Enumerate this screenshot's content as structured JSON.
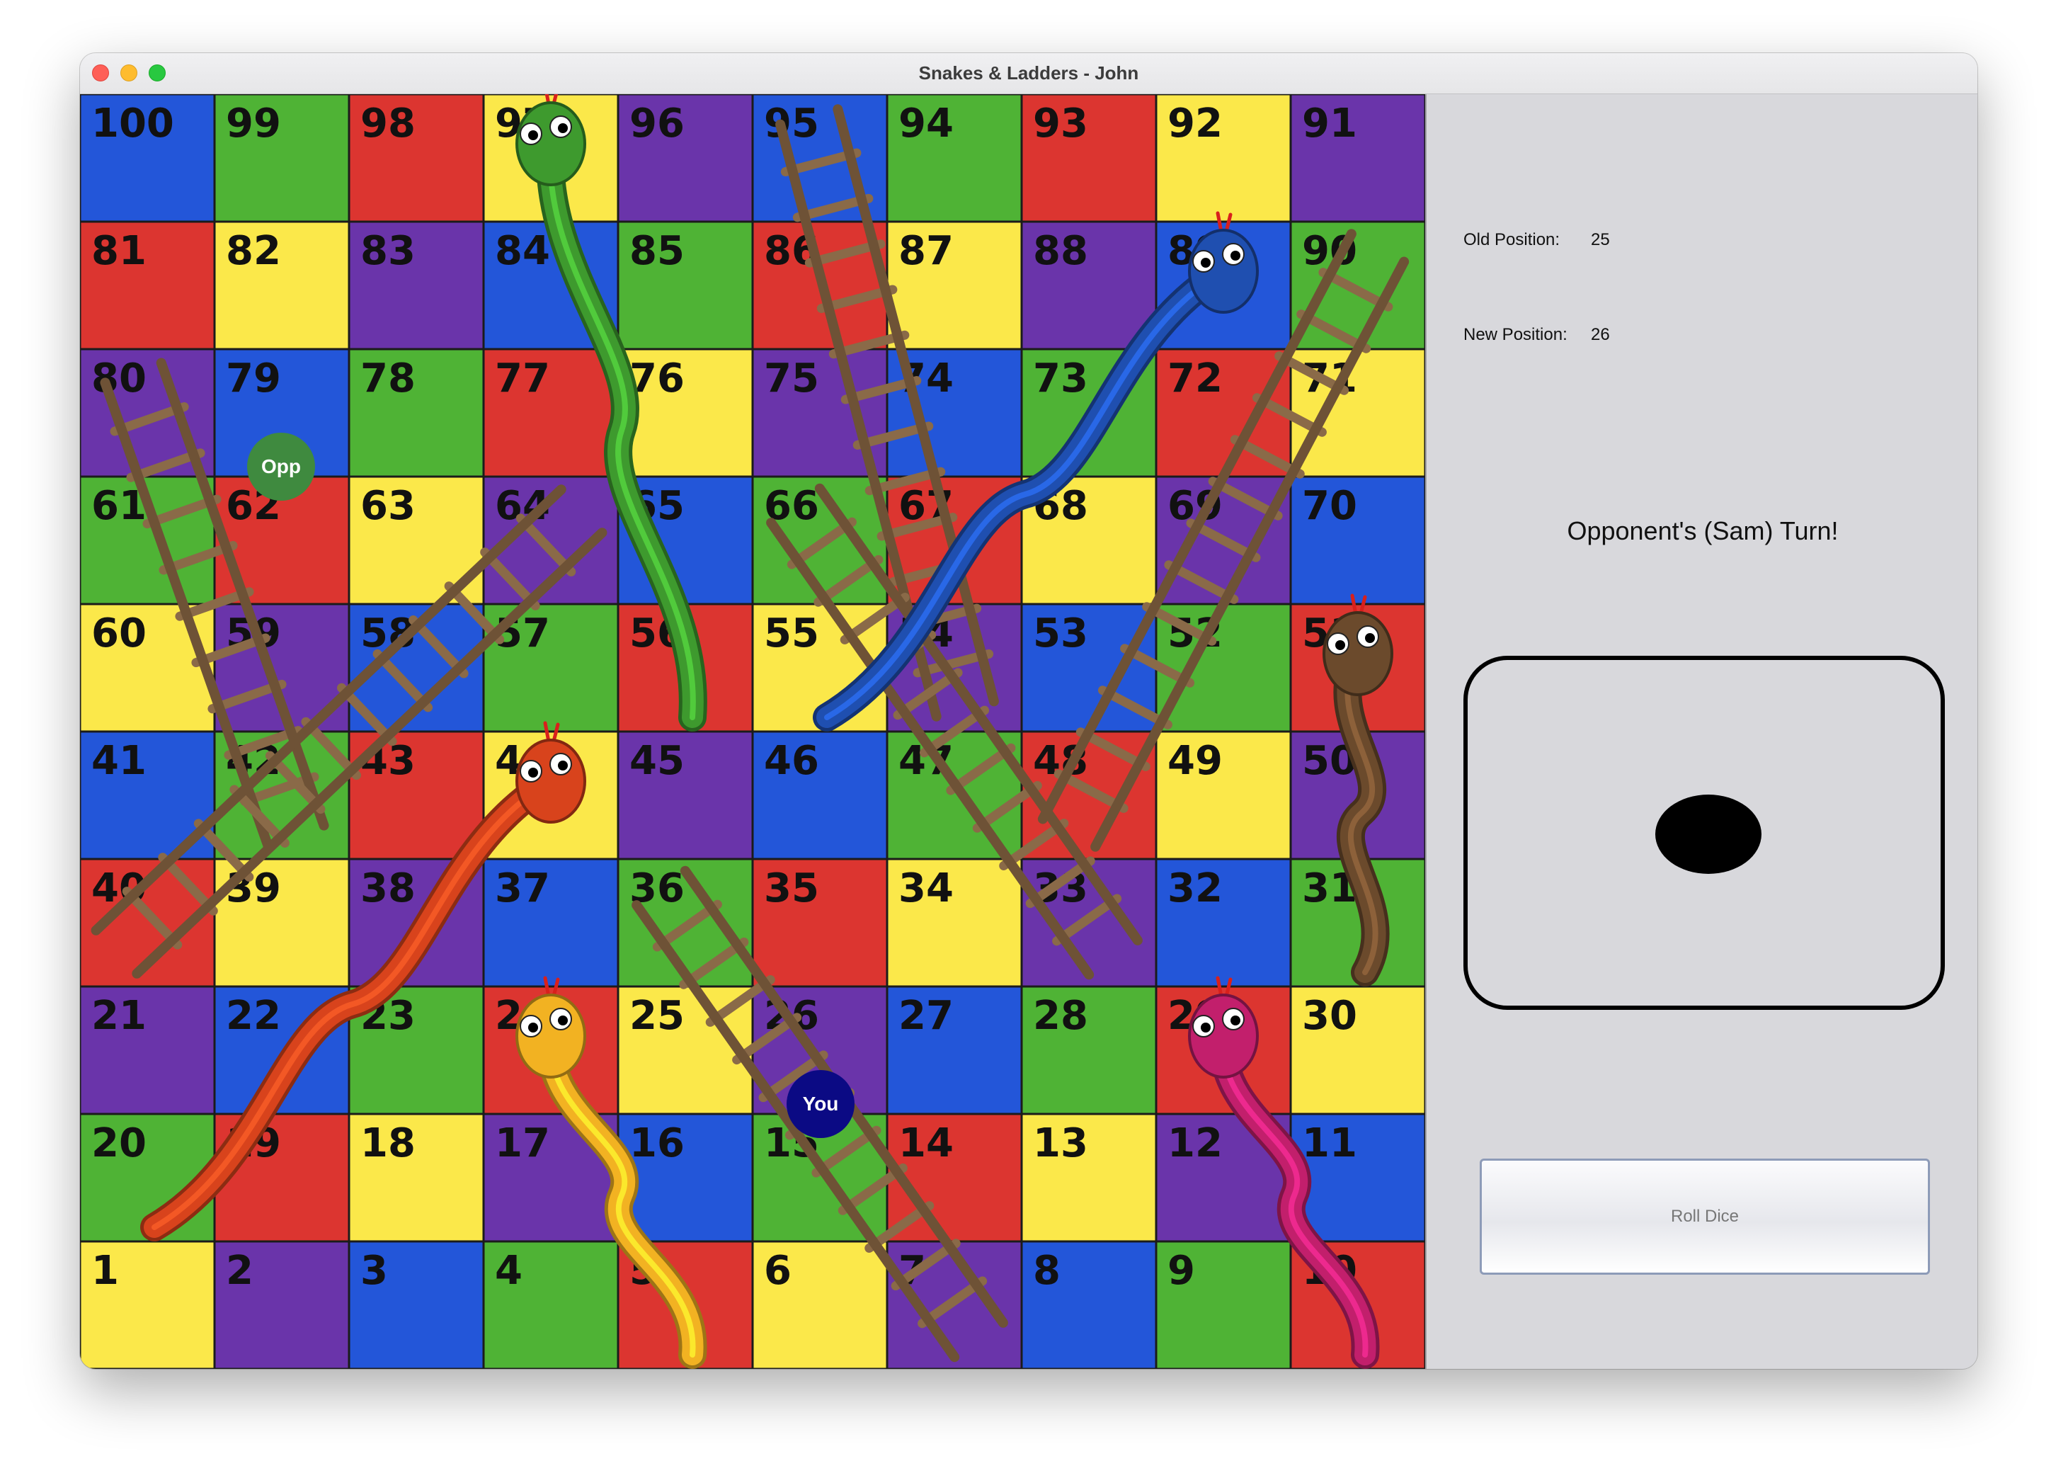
{
  "window": {
    "title": "Snakes & Ladders - John"
  },
  "board": {
    "squares_top_to_bottom": [
      [
        100,
        99,
        98,
        97,
        96,
        95,
        94,
        93,
        92,
        91
      ],
      [
        81,
        82,
        83,
        84,
        85,
        86,
        87,
        88,
        89,
        90
      ],
      [
        80,
        79,
        78,
        77,
        76,
        75,
        74,
        73,
        72,
        71
      ],
      [
        61,
        62,
        63,
        64,
        65,
        66,
        67,
        68,
        69,
        70
      ],
      [
        60,
        59,
        58,
        57,
        56,
        55,
        54,
        53,
        52,
        51
      ],
      [
        41,
        42,
        43,
        44,
        45,
        46,
        47,
        48,
        49,
        50
      ],
      [
        40,
        39,
        38,
        37,
        36,
        35,
        34,
        33,
        32,
        31
      ],
      [
        21,
        22,
        23,
        24,
        25,
        26,
        27,
        28,
        29,
        30
      ],
      [
        20,
        19,
        18,
        17,
        16,
        15,
        14,
        13,
        12,
        11
      ],
      [
        1,
        2,
        3,
        4,
        5,
        6,
        7,
        8,
        9,
        10
      ]
    ],
    "square_colors_top_to_bottom": [
      [
        "blue",
        "green",
        "red",
        "yellow",
        "purple",
        "blue",
        "green",
        "red",
        "yellow",
        "purple"
      ],
      [
        "red",
        "yellow",
        "purple",
        "blue",
        "green",
        "red",
        "yellow",
        "purple",
        "blue",
        "green"
      ],
      [
        "purple",
        "blue",
        "green",
        "red",
        "yellow",
        "purple",
        "blue",
        "green",
        "red",
        "yellow"
      ],
      [
        "green",
        "red",
        "yellow",
        "purple",
        "blue",
        "green",
        "red",
        "yellow",
        "purple",
        "blue"
      ],
      [
        "yellow",
        "purple",
        "blue",
        "green",
        "red",
        "yellow",
        "purple",
        "blue",
        "green",
        "red"
      ],
      [
        "blue",
        "green",
        "red",
        "yellow",
        "purple",
        "blue",
        "green",
        "red",
        "yellow",
        "purple"
      ],
      [
        "red",
        "yellow",
        "purple",
        "blue",
        "green",
        "red",
        "yellow",
        "purple",
        "blue",
        "green"
      ],
      [
        "purple",
        "blue",
        "green",
        "red",
        "yellow",
        "purple",
        "blue",
        "green",
        "red",
        "yellow"
      ],
      [
        "green",
        "red",
        "yellow",
        "purple",
        "blue",
        "green",
        "red",
        "yellow",
        "purple",
        "blue"
      ],
      [
        "yellow",
        "purple",
        "blue",
        "green",
        "red",
        "yellow",
        "purple",
        "blue",
        "green",
        "red"
      ]
    ],
    "palette": {
      "blue": "#2356d9",
      "green": "#4fb335",
      "red": "#dc3530",
      "yellow": "#fbe84a",
      "purple": "#6a34aa"
    },
    "ladders": [
      {
        "from": 42,
        "to": 80
      },
      {
        "from": 40,
        "to": 64
      },
      {
        "from": 54,
        "to": 95
      },
      {
        "from": 33,
        "to": 66
      },
      {
        "from": 7,
        "to": 36
      },
      {
        "from": 48,
        "to": 90
      }
    ],
    "snakes": [
      {
        "head": 97,
        "tail": 56,
        "color": "#3e9a2e"
      },
      {
        "head": 89,
        "tail": 55,
        "color": "#1f4fb0"
      },
      {
        "head": 51,
        "tail": 31,
        "color": "#6b4a2c"
      },
      {
        "head": 44,
        "tail": 20,
        "color": "#d8431c"
      },
      {
        "head": 24,
        "tail": 5,
        "color": "#f2b222"
      },
      {
        "head": 29,
        "tail": 10,
        "color": "#c21f6c"
      }
    ]
  },
  "players": {
    "opponent": {
      "label": "Opp",
      "square": 79,
      "color": "#3f8a3f"
    },
    "you": {
      "label": "You",
      "square": 26,
      "color": "#0b0a84"
    }
  },
  "panel": {
    "old_position_label": "Old Position:",
    "old_position_value": "25",
    "new_position_label": "New Position:",
    "new_position_value": "26",
    "turn_text": "Opponent's (Sam) Turn!",
    "die_value": 1,
    "roll_button_label": "Roll Dice"
  }
}
